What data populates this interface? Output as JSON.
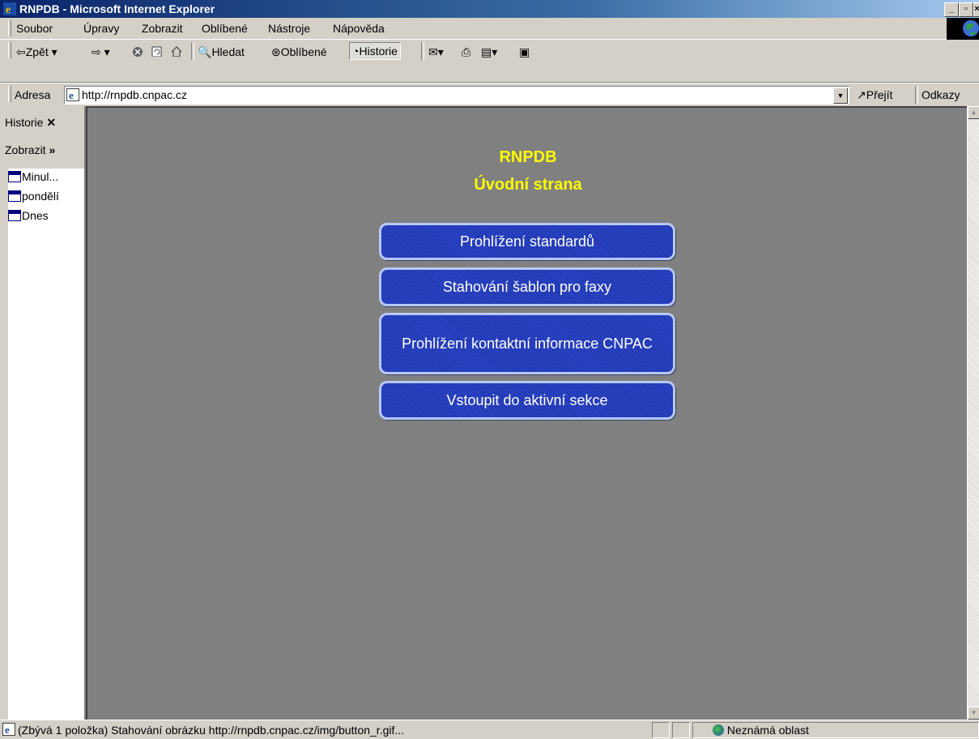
{
  "window": {
    "title": "RNPDB - Microsoft Internet Explorer"
  },
  "menu": [
    "Soubor",
    "Úpravy",
    "Zobrazit",
    "Oblíbené",
    "Nástroje",
    "Nápověda"
  ],
  "toolbar": {
    "back": "⇦Zpět ▾",
    "forward": "⇨ ▾",
    "search": "Hledat",
    "favorites": "Oblíbené",
    "history": "Historie"
  },
  "address": {
    "label": "Adresa",
    "url": "http://rnpdb.cnpac.cz",
    "go": "Přejít",
    "links": "Odkazy"
  },
  "history_pane": {
    "title": "Historie",
    "view": "Zobrazit",
    "items": [
      "Minul...",
      "pondělí",
      "Dnes"
    ]
  },
  "page": {
    "title": "RNPDB",
    "subtitle": "Úvodní strana",
    "buttons": [
      "Prohlížení standardů",
      "Stahování šablon pro faxy",
      "Prohlížení kontaktní informace CNPAC",
      "Vstoupit do aktivní sekce"
    ]
  },
  "status": {
    "text": "(Zbývá 1 položka) Stahování obrázku http://rnpdb.cnpac.cz/img/button_r.gif...",
    "zone": "Neznámá oblast"
  }
}
